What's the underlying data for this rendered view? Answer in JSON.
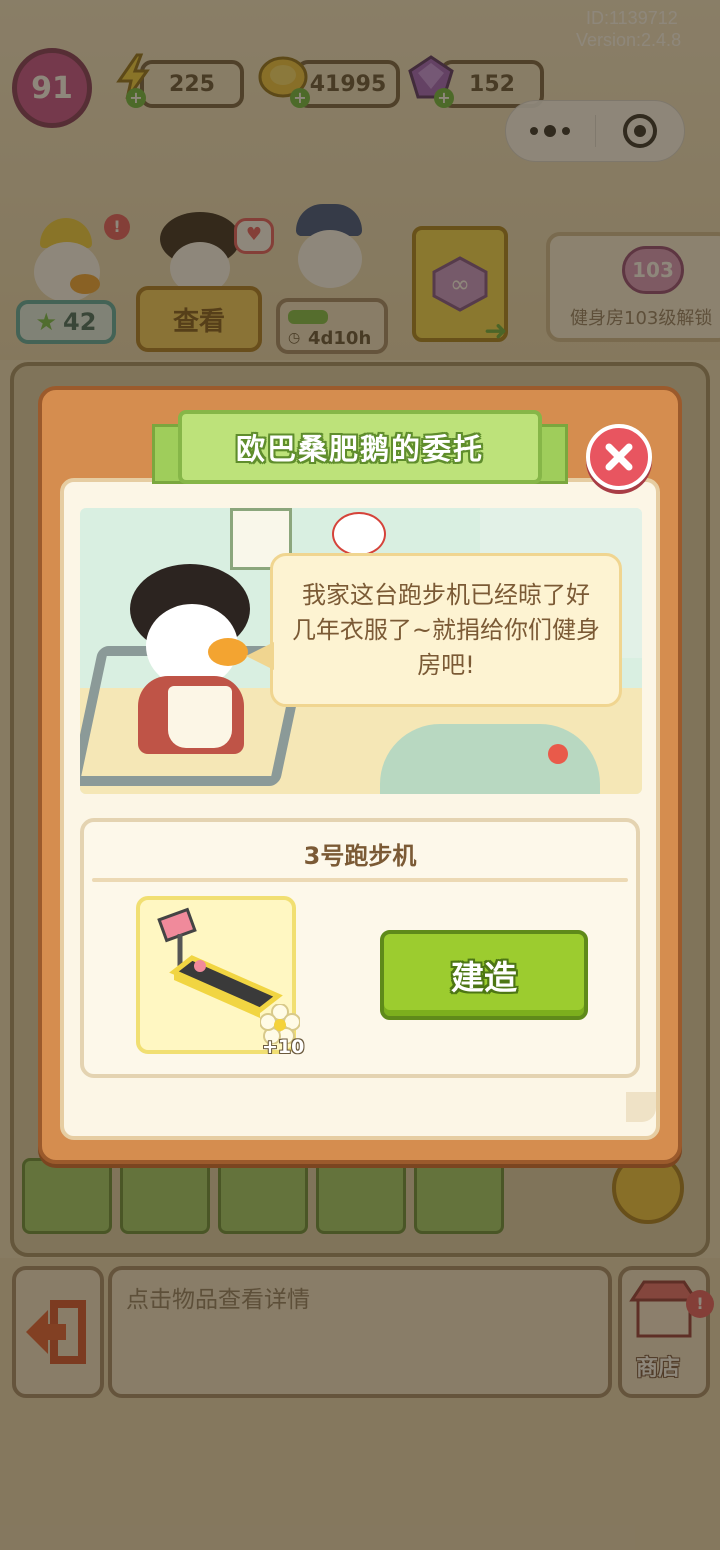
{
  "meta": {
    "id_label": "ID:1139712",
    "version_label": "Version:2.4.8"
  },
  "hud": {
    "level": "91",
    "energy": "225",
    "coins": "41995",
    "gems": "152",
    "star_count": "42",
    "view_button": "查看",
    "timer": "4d10h",
    "room_level": "103",
    "room_unlock_text": "健身房103级解锁"
  },
  "dialog": {
    "title": "欧巴桑肥鹅的委托",
    "speech": "我家这台跑步机已经晾了好几年衣服了~就捐给你们健身房吧!",
    "item_name": "3号跑步机",
    "reward": "+10",
    "build_button": "建造"
  },
  "bottom": {
    "hint": "点击物品查看详情",
    "shop_label": "商店"
  },
  "colors": {
    "panel": "#d58d4f",
    "title_green": "#bde27a",
    "build_green": "#9ccc2f",
    "close_red": "#e85560"
  }
}
